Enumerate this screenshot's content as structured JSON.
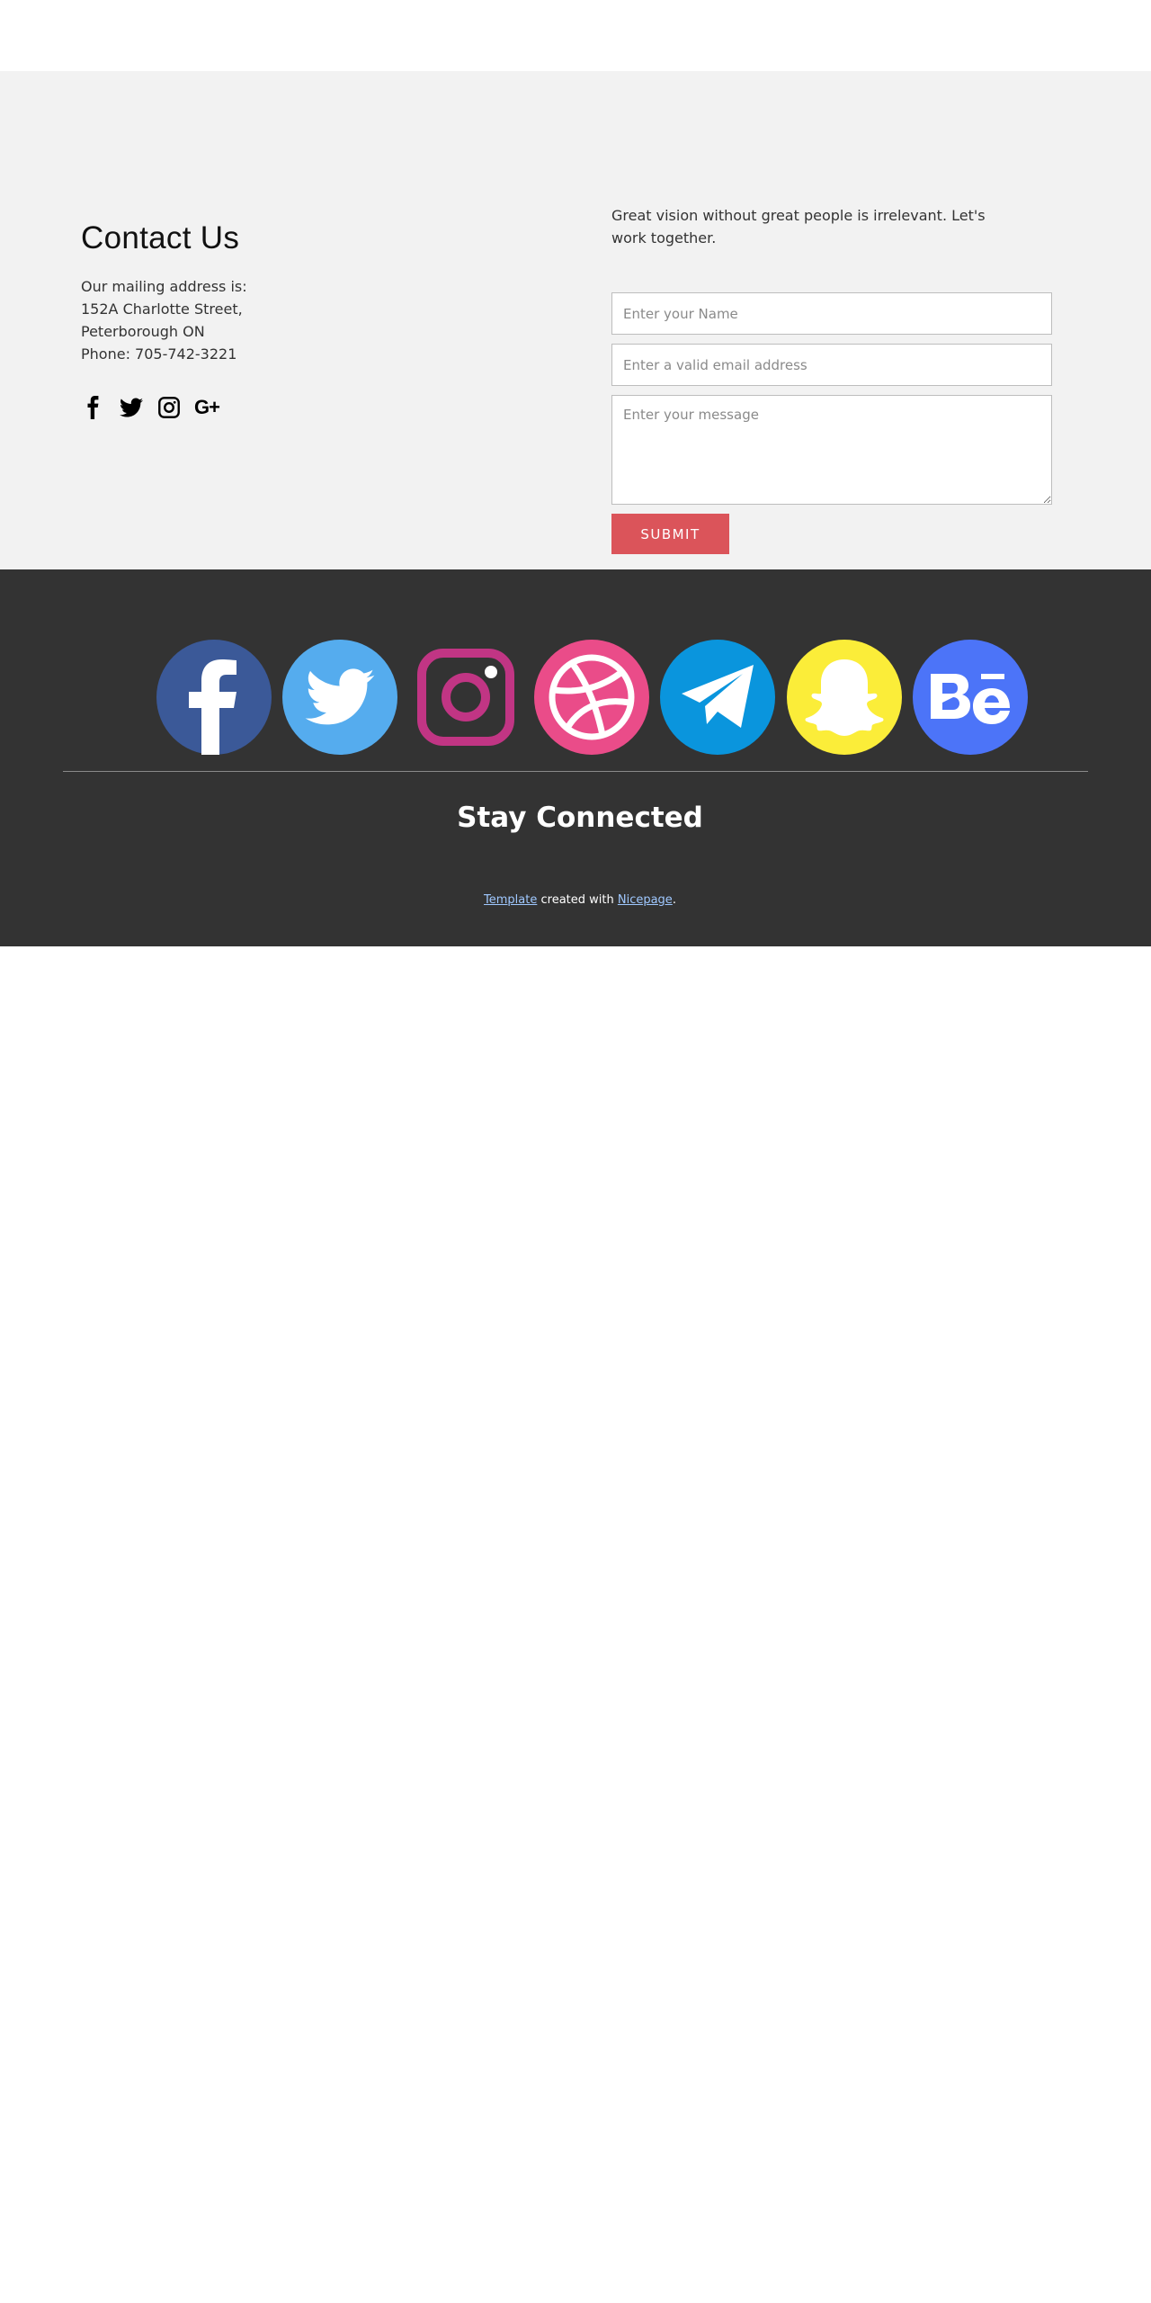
{
  "contact": {
    "title": "Contact Us",
    "address_lines": [
      "Our mailing address is:",
      "152A Charlotte Street,",
      "Peterborough ON",
      "Phone: 705-742-3221"
    ],
    "small_social_icons": [
      "facebook-icon",
      "twitter-icon",
      "instagram-icon",
      "google-plus-icon"
    ],
    "google_plus_label": "G+"
  },
  "form": {
    "tagline": "Great vision without great people is irrelevant. Let's work together.",
    "name_placeholder": "Enter your Name",
    "email_placeholder": "Enter a valid email address",
    "message_placeholder": "Enter your message",
    "submit_label": "SUBMIT"
  },
  "footer": {
    "social_icons": [
      {
        "name": "facebook-icon",
        "color": "#3b5998"
      },
      {
        "name": "twitter-icon",
        "color": "#55acee"
      },
      {
        "name": "instagram-icon",
        "color": "#c13584"
      },
      {
        "name": "dribbble-icon",
        "color": "#ea4c89"
      },
      {
        "name": "telegram-icon",
        "color": "#0088cc"
      },
      {
        "name": "snapchat-icon",
        "color": "#fffc00"
      },
      {
        "name": "behance-icon",
        "color": "#1769ff"
      }
    ],
    "heading": "Stay Connected",
    "credit_link1": "Template",
    "credit_middle": " created with ",
    "credit_link2": "Nicepage",
    "credit_end": "."
  },
  "colors": {
    "section_bg": "#f2f2f2",
    "footer_bg": "#333333",
    "submit_bg": "#db545a"
  }
}
